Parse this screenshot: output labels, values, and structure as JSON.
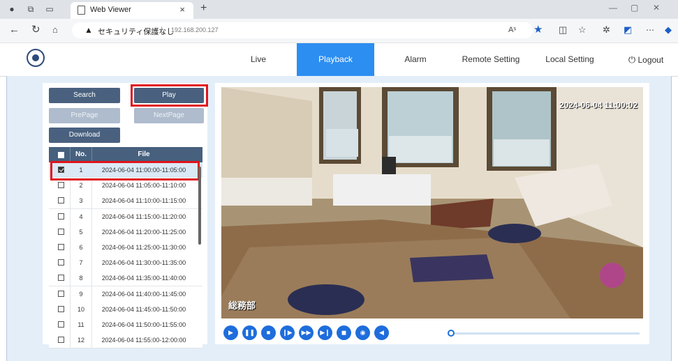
{
  "browser": {
    "tab_title": "Web Viewer",
    "tab_close": "×",
    "new_tab": "+",
    "security_label": "セキュリティ保護なし",
    "separator": "|",
    "host": "192.168.200.127",
    "window_controls": [
      "—",
      "▢",
      "✕"
    ],
    "toolbar_icons": [
      "read-aloud-icon",
      "favorite-star-icon",
      "split-screen-icon",
      "favorites-icon",
      "extensions-icon",
      "collections-icon",
      "more-icon",
      "copilot-icon"
    ]
  },
  "nav": {
    "items": [
      {
        "label": "Live"
      },
      {
        "label": "Playback",
        "active": true
      },
      {
        "label": "Alarm"
      },
      {
        "label": "Remote Setting"
      },
      {
        "label": "Local Setting"
      }
    ],
    "logout_label": "Logout",
    "active_color": "#2c8ef0"
  },
  "panel": {
    "search_label": "Search",
    "play_label": "Play",
    "prepage_label": "PrePage",
    "nextpage_label": "NextPage",
    "download_label": "Download",
    "table": {
      "headers": {
        "no": "No.",
        "file": "File"
      },
      "rows": [
        {
          "no": "1",
          "file": "2024-06-04 11:00:00-11:05:00",
          "checked": true
        },
        {
          "no": "2",
          "file": "2024-06-04 11:05:00-11:10:00",
          "checked": false
        },
        {
          "no": "3",
          "file": "2024-06-04 11:10:00-11:15:00",
          "checked": false
        },
        {
          "no": "4",
          "file": "2024-06-04 11:15:00-11:20:00",
          "checked": false
        },
        {
          "no": "5",
          "file": "2024-06-04 11:20:00-11:25:00",
          "checked": false
        },
        {
          "no": "6",
          "file": "2024-06-04 11:25:00-11:30:00",
          "checked": false
        },
        {
          "no": "7",
          "file": "2024-06-04 11:30:00-11:35:00",
          "checked": false
        },
        {
          "no": "8",
          "file": "2024-06-04 11:35:00-11:40:00",
          "checked": false
        },
        {
          "no": "9",
          "file": "2024-06-04 11:40:00-11:45:00",
          "checked": false
        },
        {
          "no": "10",
          "file": "2024-06-04 11:45:00-11:50:00",
          "checked": false
        },
        {
          "no": "11",
          "file": "2024-06-04 11:50:00-11:55:00",
          "checked": false
        },
        {
          "no": "12",
          "file": "2024-06-04 11:55:00-12:00:00",
          "checked": false
        }
      ]
    }
  },
  "video": {
    "timestamp": "2024-06-04 11:00:02",
    "camera_name": "総務部",
    "controls": [
      "play-icon",
      "pause-icon",
      "stop-icon",
      "slow-icon",
      "fast-icon",
      "step-icon",
      "record-icon",
      "snapshot-icon",
      "audio-icon"
    ],
    "progress": 0.0
  },
  "colors": {
    "button": "#49617f",
    "button_disabled": "#aebccd",
    "highlight": "#e0141b",
    "control": "#1e6ddc"
  }
}
